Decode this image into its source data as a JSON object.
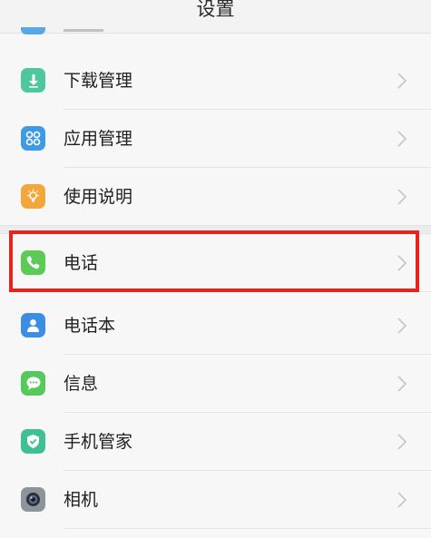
{
  "header": {
    "title": "设置"
  },
  "settings": {
    "items": [
      {
        "label": "下载管理",
        "icon": "download-icon",
        "color": "#4fc79e"
      },
      {
        "label": "应用管理",
        "icon": "apps-grid-icon",
        "color": "#3f9ae6"
      },
      {
        "label": "使用说明",
        "icon": "lightbulb-icon",
        "color": "#f3a73b"
      },
      {
        "label": "电话",
        "icon": "phone-icon",
        "color": "#5ccb55"
      },
      {
        "label": "电话本",
        "icon": "contacts-icon",
        "color": "#3c8ee4"
      },
      {
        "label": "信息",
        "icon": "message-icon",
        "color": "#55c959"
      },
      {
        "label": "手机管家",
        "icon": "shield-icon",
        "color": "#3fbf94"
      },
      {
        "label": "相机",
        "icon": "camera-icon",
        "color": "#8e949b"
      }
    ]
  },
  "highlight": {
    "target": "电话",
    "color": "#e8231c"
  }
}
